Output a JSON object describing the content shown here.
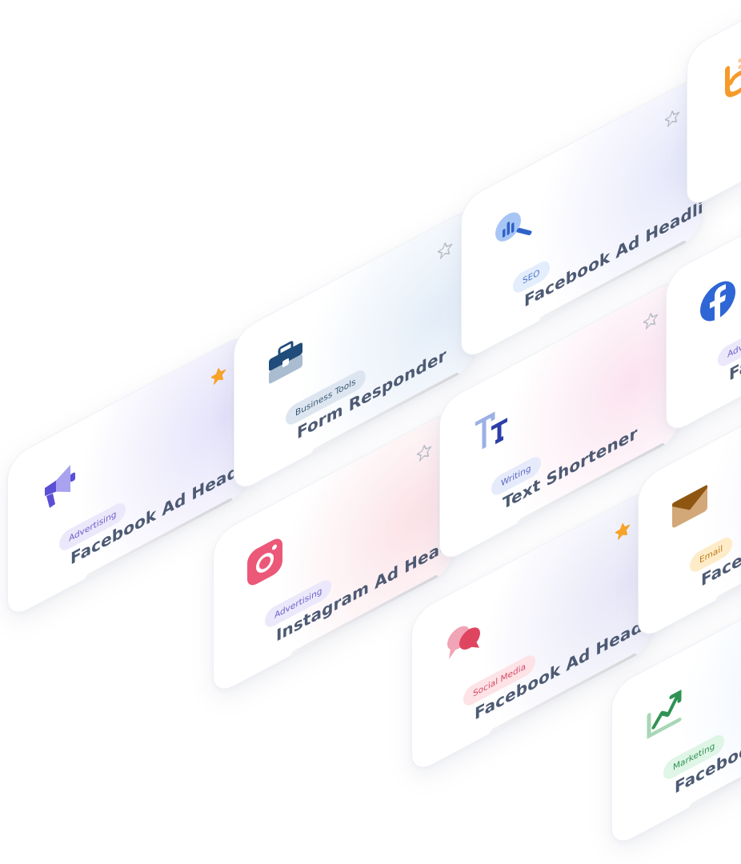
{
  "cards": [
    {
      "title": "Facebook Ad Headline",
      "category": "Advertising",
      "icon": "megaphone-icon",
      "favorite": true,
      "badge_bg": "#ebe8fb",
      "badge_fg": "#6b5fc8",
      "glow": "#e4e2fa"
    },
    {
      "title": "Form Responder",
      "category": "Business Tools",
      "icon": "briefcase-icon",
      "favorite": false,
      "badge_bg": "#dde6f0",
      "badge_fg": "#3c5875",
      "glow": "#e3edf8"
    },
    {
      "title": "Facebook Ad Headline",
      "category": "SEO",
      "icon": "seo-analytics-icon",
      "favorite": false,
      "badge_bg": "#e3edfc",
      "badge_fg": "#4b78c8",
      "glow": "#e6e8fb"
    },
    {
      "title": "Instagram Ad Headline",
      "category": "Advertising",
      "icon": "instagram-icon",
      "favorite": false,
      "badge_bg": "#ebe8fb",
      "badge_fg": "#6b5fc8",
      "glow": "#fbe2e7"
    },
    {
      "title": "Text Shortener",
      "category": "Writing",
      "icon": "text-size-icon",
      "favorite": false,
      "badge_bg": "#e6ebfb",
      "badge_fg": "#5866c0",
      "glow": "#fbe3ef"
    },
    {
      "title": "Facebook Ad Headline",
      "category": "Social Media",
      "icon": "chat-bubbles-icon",
      "favorite": true,
      "badge_bg": "#fde2e6",
      "badge_fg": "#d24d66",
      "glow": "#e6e6f8"
    },
    {
      "title": "Facebook Ad Headline",
      "category": "Marketing",
      "icon": "trend-up-icon",
      "favorite": false,
      "badge_bg": "#dff5e6",
      "badge_fg": "#2f9254",
      "glow": "#e9f2ff"
    },
    {
      "title": "Facebook Ad Headline",
      "category": "Email",
      "icon": "envelope-icon",
      "favorite": false,
      "badge_bg": "#feecc9",
      "badge_fg": "#bd7a16",
      "glow": "#f3eefb"
    },
    {
      "title": "Facebook Ad Headline",
      "category": "Advertising",
      "icon": "facebook-icon",
      "favorite": false,
      "badge_bg": "#ebe8fb",
      "badge_fg": "#6b5fc8",
      "glow": "#e9ecfb"
    },
    {
      "title": "",
      "category": "",
      "icon": "wifi-logo-icon",
      "favorite": false,
      "badge_bg": "#ebe8fb",
      "badge_fg": "#6b5fc8",
      "glow": "#f2f2fa"
    }
  ],
  "colors": {
    "star_active": "#f7a428",
    "star_inactive": "#b8bcc6",
    "title": "#4d5a73"
  }
}
